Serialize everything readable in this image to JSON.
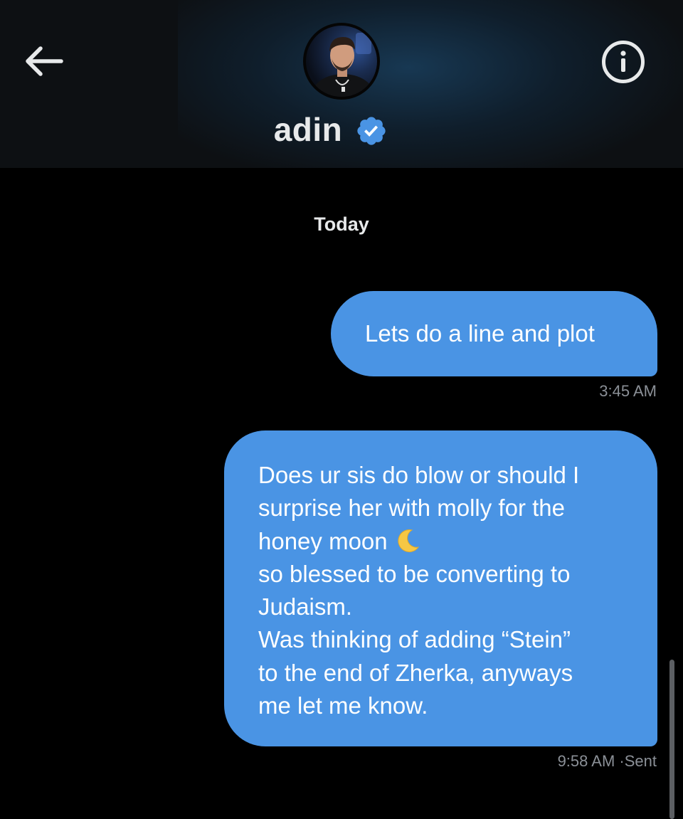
{
  "header": {
    "back_icon": "arrow-left-icon",
    "info_icon": "info-icon",
    "contact_name": "adin",
    "verified_icon": "verified-badge-icon",
    "avatar_icon": "profile-photo"
  },
  "conversation": {
    "date_divider": "Today",
    "messages": [
      {
        "direction": "sent",
        "lines": [
          "Lets do a line and plot"
        ],
        "time": "3:45 AM",
        "status": ""
      },
      {
        "direction": "sent",
        "lines": [
          "Does ur sis do blow or should I",
          "surprise her with molly for the",
          "honey moon",
          "so blessed to be converting to",
          "Judaism.",
          "Was thinking of adding “Stein”",
          "to the end of Zherka, anyways",
          "me let me know."
        ],
        "emoji": "🌙",
        "time": "9:58 AM",
        "status": "Sent"
      }
    ]
  },
  "colors": {
    "background": "#000000",
    "header_background": "#0d1013",
    "bubble_sent": "#4a94e4",
    "verified_badge": "#4a94e4",
    "meta_text": "#8b9097",
    "primary_text": "#e7e9ea"
  }
}
